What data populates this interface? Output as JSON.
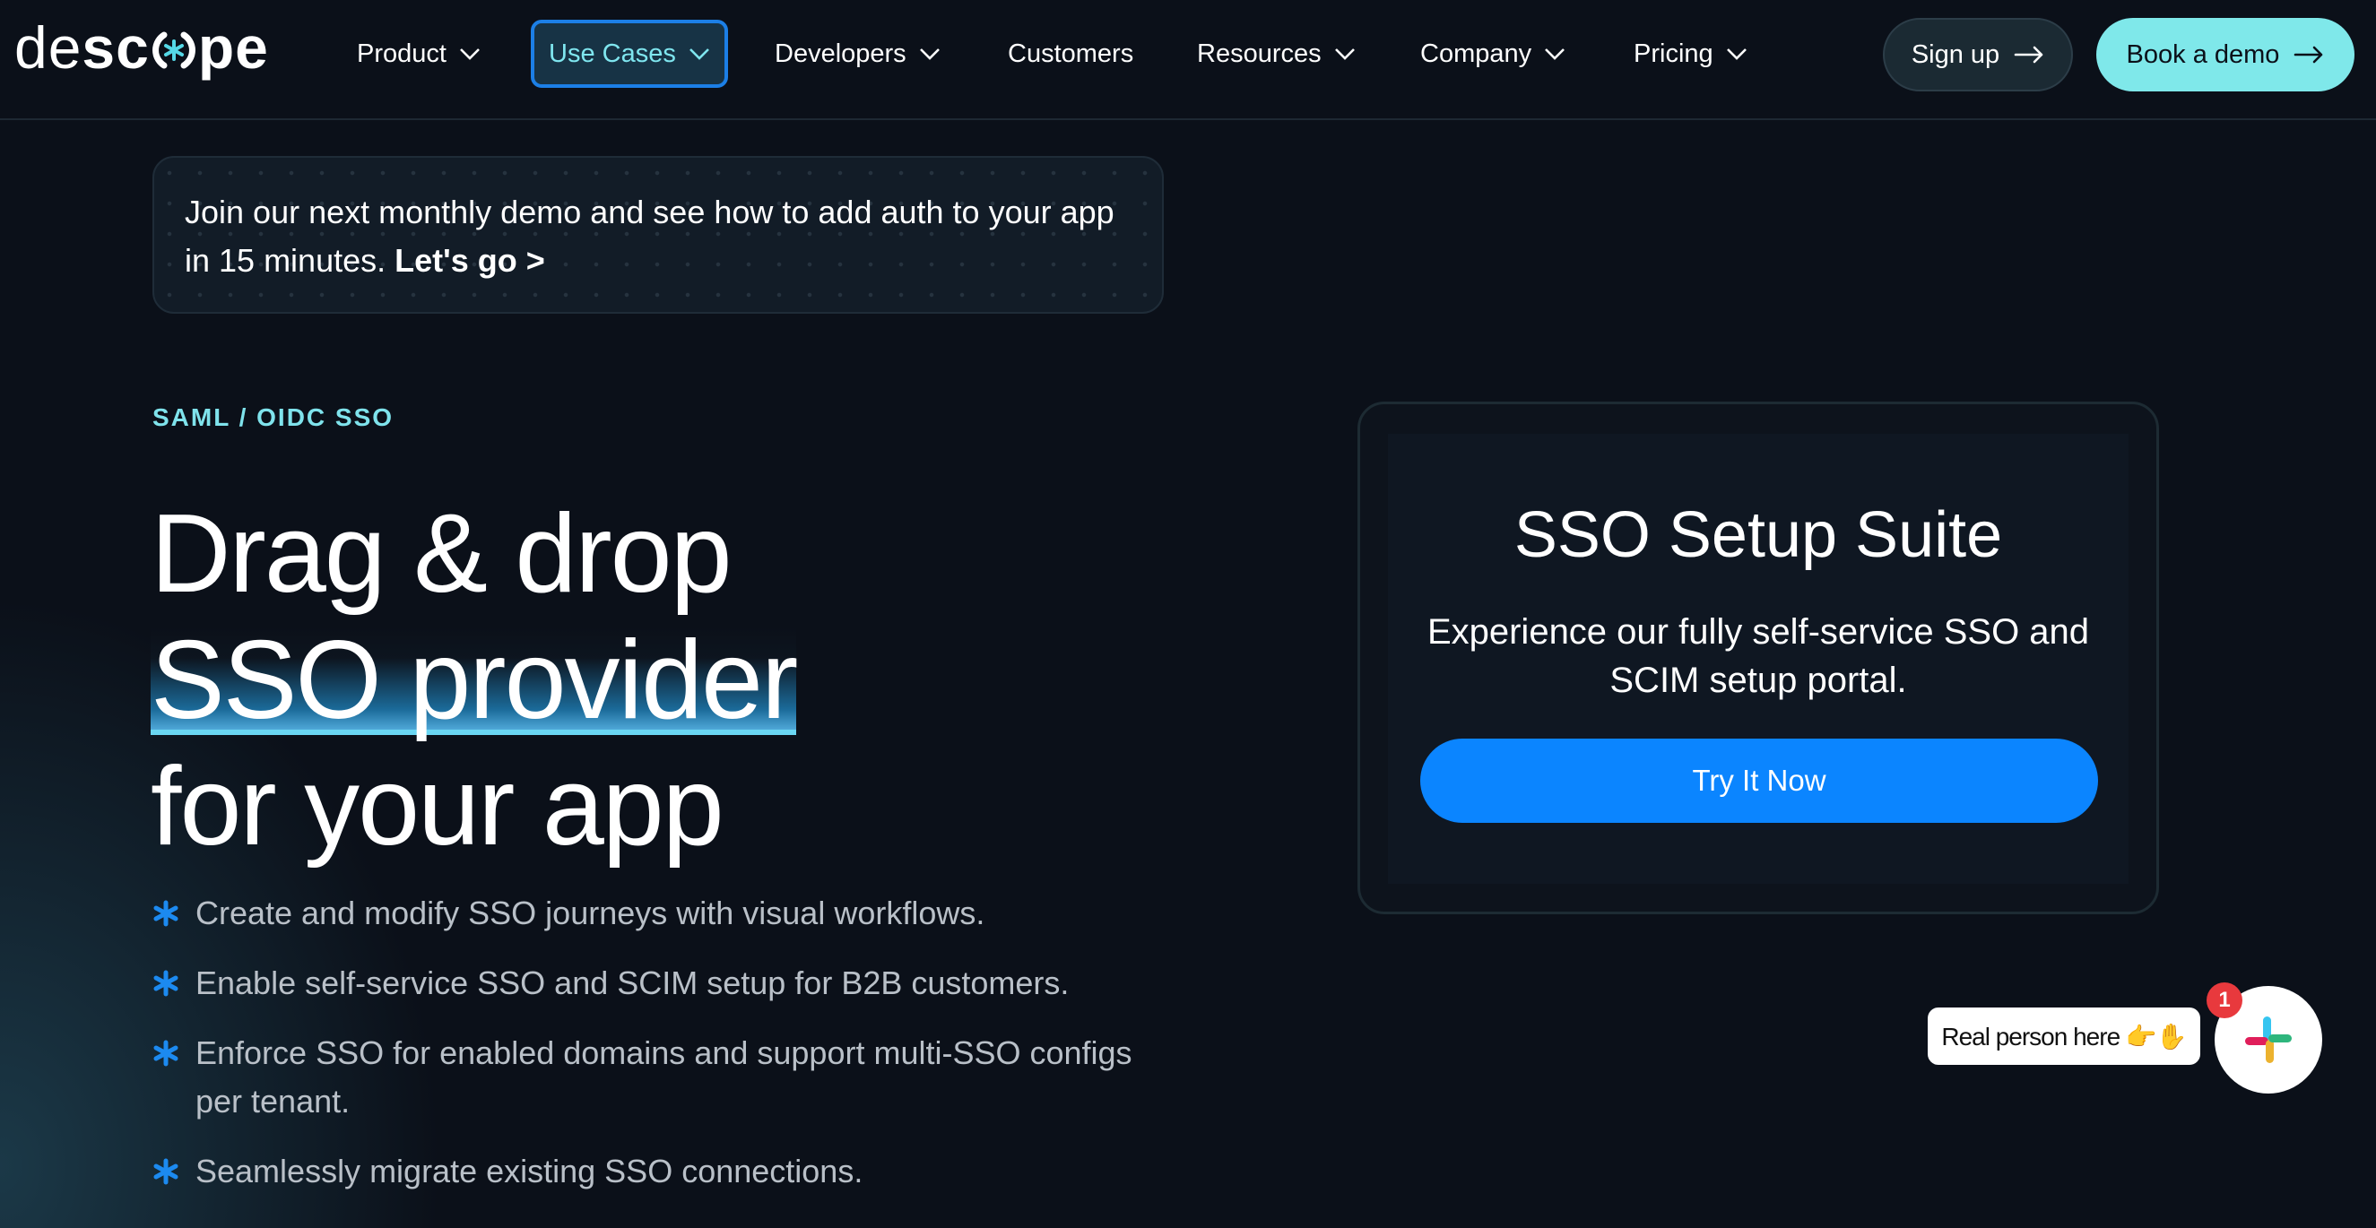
{
  "header": {
    "logo": {
      "part1": "de",
      "part2": "sc",
      "part3": "pe"
    },
    "nav": [
      {
        "label": "Product",
        "dropdown": true
      },
      {
        "label": "Use Cases",
        "dropdown": true,
        "active": true
      },
      {
        "label": "Developers",
        "dropdown": true
      },
      {
        "label": "Customers",
        "dropdown": false
      },
      {
        "label": "Resources",
        "dropdown": true
      },
      {
        "label": "Company",
        "dropdown": true
      },
      {
        "label": "Pricing",
        "dropdown": true
      }
    ],
    "signup_label": "Sign up",
    "demo_label": "Book a demo"
  },
  "banner": {
    "text": "Join our next monthly demo and see how to add auth to your app in 15 minutes.",
    "link": "Let's go >"
  },
  "hero": {
    "eyebrow": "SAML / OIDC SSO",
    "title_line1": "Drag & drop",
    "title_highlight": "SSO provider",
    "title_line3": "for your app",
    "features": [
      "Create and modify SSO journeys with visual workflows.",
      "Enable self-service SSO and SCIM setup for B2B customers.",
      "Enforce SSO for enabled domains and support multi-SSO configs per tenant.",
      "Seamlessly migrate existing SSO connections."
    ]
  },
  "card": {
    "title": "SSO Setup Suite",
    "subtitle": "Experience our fully self-service SSO and SCIM setup portal.",
    "button": "Try It Now"
  },
  "chat": {
    "bubble": "Real person here 👉✋",
    "badge": "1"
  },
  "colors": {
    "background": "#0b1019",
    "accent_cyan": "#7fe8ea",
    "primary_blue": "#0b85ff",
    "active_nav_border": "#1c7fe6",
    "badge_red": "#e8393d"
  },
  "icons": {
    "chevron": "chevron-down-icon",
    "arrow": "arrow-right-icon",
    "bullet": "asterisk-icon",
    "chat": "slack-icon"
  }
}
